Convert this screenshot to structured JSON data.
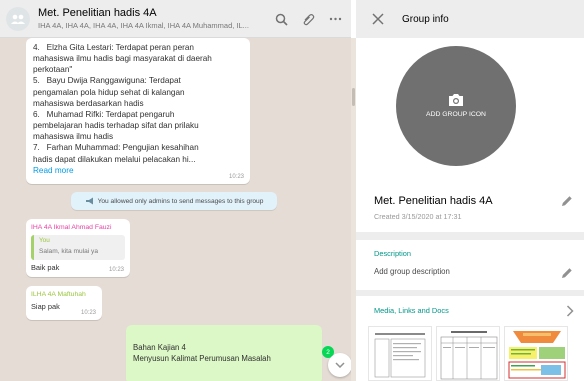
{
  "chat": {
    "title": "Met. Penelitian hadis 4A",
    "subtitle": "IHA 4A, IHA 4A, IHA 4A, IHA 4A Ikmal, IHA 4A Muhammad, IL...",
    "message1": {
      "lines": [
        "4.   Elzha Gita Lestari: Terdapat peran peran",
        "mahasiswa ilmu hadis bagi masyarakat di daerah",
        "perkotaan\"",
        "5.   Bayu Dwija Ranggawiguna: Terdapat",
        "pengamalan pola hidup sehat di kalangan",
        "mahasiswa berdasarkan hadis",
        "6.   Muhamad Rifki: Terdapat pengaruh",
        "pembelajaran hadis terhadap sifat dan prilaku",
        "mahasiswa ilmu hadis",
        "7.   Farhan Muhammad: Pengujian kesahihan",
        "hadis dapat dilakukan melalui pelacakan hi..."
      ],
      "read_more": "Read more",
      "time": "10:23"
    },
    "system_note": "You allowed only admins to send messages to this group",
    "message2": {
      "sender": "IHA 4A Ikmal Ahmad Fauzi",
      "quote_author": "You",
      "quote_text": "Salam, kita mulai ya",
      "text": "Baik pak",
      "time": "10:23"
    },
    "message3": {
      "sender": "ILHA 4A Maftuhah",
      "text": "Siap pak",
      "time": "10:23"
    },
    "message4": {
      "line1": "Bahan Kajian 4",
      "line2": "Menyusun Kalimat Perumusan Masalah"
    },
    "unread_count": "2"
  },
  "info": {
    "header_title": "Group info",
    "add_group_icon_label": "ADD GROUP ICON",
    "group_name": "Met. Penelitian hadis 4A",
    "created": "Created 3/15/2020 at 17:31",
    "description_label": "Description",
    "description_value": "Add group description",
    "media_label": "Media, Links and Docs"
  },
  "colors": {
    "chat_bg": "#e5ddd5",
    "outgoing_bubble": "#dcf8c6",
    "accent_teal": "#009688",
    "sender_pink": "#e542a3",
    "sender_green": "#9bc53d",
    "badge_green": "#06d755"
  }
}
